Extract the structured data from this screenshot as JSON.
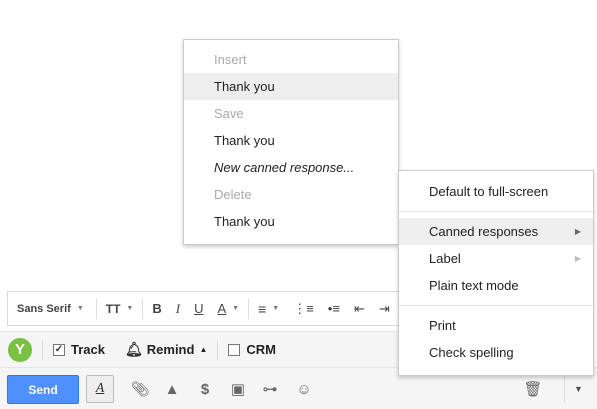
{
  "format_toolbar": {
    "font": "Sans Serif",
    "size_icon": "TT",
    "bold": "B",
    "italic": "I",
    "underline": "U",
    "text_color": "A"
  },
  "extension_bar": {
    "logo_letter": "Y",
    "track": "Track",
    "remind": "Remind",
    "crm": "CRM",
    "check_mark": "✓"
  },
  "bottom_bar": {
    "send": "Send",
    "format_toggle": "A"
  },
  "canned_menu": {
    "insert_header": "Insert",
    "insert_item": "Thank you",
    "save_header": "Save",
    "save_item": "Thank you",
    "new_response": "New canned response...",
    "delete_header": "Delete",
    "delete_item": "Thank you"
  },
  "more_menu": {
    "default_fullscreen": "Default to full-screen",
    "canned_responses": "Canned responses",
    "label": "Label",
    "plain_text": "Plain text mode",
    "print": "Print",
    "check_spelling": "Check spelling"
  },
  "colors": {
    "send_blue": "#4d90fe",
    "highlight": "#eeeeee",
    "logo_green": "#7ac143"
  }
}
